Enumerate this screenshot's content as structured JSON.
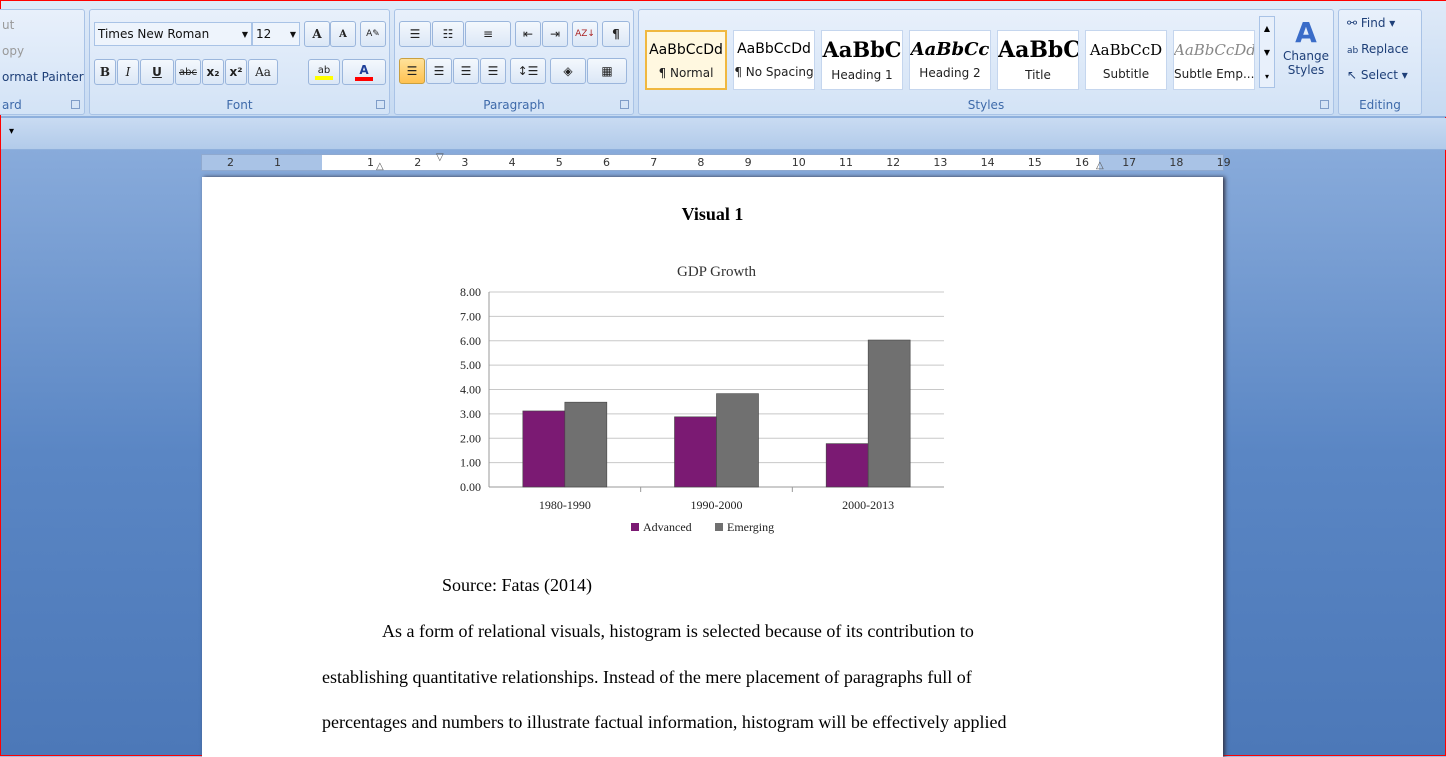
{
  "ribbon": {
    "clipboard": {
      "cut": "ut",
      "copy": "opy",
      "format_painter": "ormat Painter",
      "label": "ard"
    },
    "font": {
      "name": "Times New Roman",
      "size": "12",
      "label": "Font",
      "bold": "B",
      "italic": "I",
      "underline": "U",
      "strike": "abc",
      "sub": "x₂",
      "sup": "x²",
      "case": "Aa",
      "grow": "A",
      "shrink": "A",
      "highlight_color": "#ffff00",
      "font_color": "#ff0000"
    },
    "paragraph": {
      "label": "Paragraph",
      "pilcrow": "¶"
    },
    "styles": {
      "label": "Styles",
      "items": [
        {
          "preview": "AaBbCcDd",
          "name": "¶ Normal"
        },
        {
          "preview": "AaBbCcDd",
          "name": "¶ No Spacing"
        },
        {
          "preview": "AaBbC",
          "name": "Heading 1"
        },
        {
          "preview": "AaBbCc",
          "name": "Heading 2"
        },
        {
          "preview": "AaBbC",
          "name": "Title"
        },
        {
          "preview": "AaBbCcD",
          "name": "Subtitle"
        },
        {
          "preview": "AaBbCcDd",
          "name": "Subtle Emp..."
        }
      ],
      "change_styles": "Change Styles"
    },
    "editing": {
      "label": "Editing",
      "find": "Find",
      "replace": "Replace",
      "select": "Select"
    }
  },
  "ruler": {
    "labels": [
      "2",
      "1",
      "1",
      "2",
      "3",
      "4",
      "5",
      "6",
      "7",
      "8",
      "9",
      "10",
      "11",
      "12",
      "13",
      "14",
      "15",
      "16",
      "17",
      "18",
      "19"
    ]
  },
  "document": {
    "heading": "Visual 1",
    "source": "Source: Fatas (2014)",
    "paragraph_lines": [
      "As a form of relational visuals, histogram is selected because of its contribution to",
      "establishing quantitative relationships. Instead of the mere placement of paragraphs full of",
      "percentages and numbers to illustrate factual information, histogram will be effectively applied"
    ]
  },
  "chart_data": {
    "type": "bar",
    "title": "GDP Growth",
    "categories": [
      "1980-1990",
      "1990-2000",
      "2000-2013"
    ],
    "series": [
      {
        "name": "Advanced",
        "values": [
          3.12,
          2.88,
          1.78
        ],
        "color": "#7b1a73"
      },
      {
        "name": "Emerging",
        "values": [
          3.48,
          3.83,
          6.03
        ],
        "color": "#707070"
      }
    ],
    "ylim": [
      0,
      8
    ],
    "yticks": [
      "0.00",
      "1.00",
      "2.00",
      "3.00",
      "4.00",
      "5.00",
      "6.00",
      "7.00",
      "8.00"
    ],
    "grid": true,
    "legend": "bottom"
  }
}
